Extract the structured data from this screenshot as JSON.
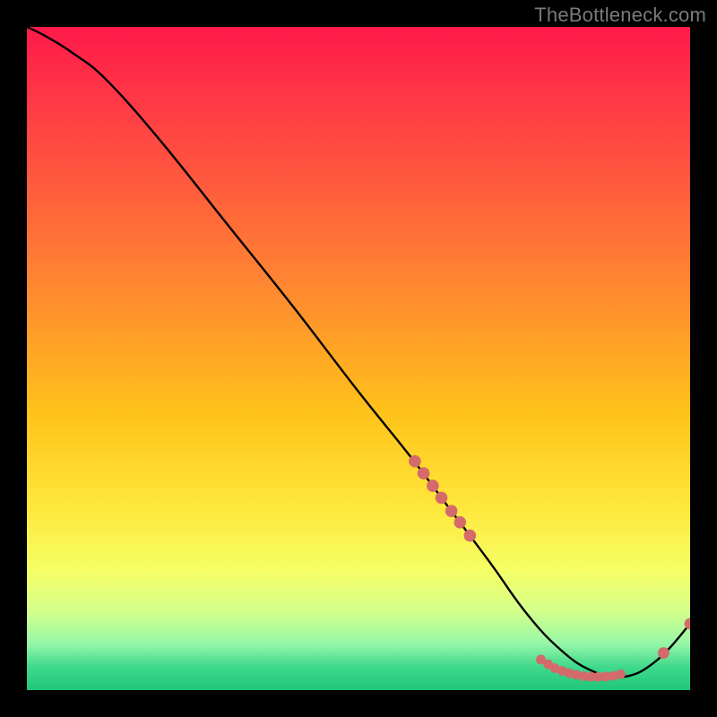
{
  "watermark": "TheBottleneck.com",
  "chart_data": {
    "type": "line",
    "title": "",
    "xlabel": "",
    "ylabel": "",
    "xlim": [
      0,
      100
    ],
    "ylim": [
      0,
      100
    ],
    "grid": false,
    "legend": false,
    "gradient_stops": [
      {
        "offset": 0.0,
        "color": "#ff1a4b"
      },
      {
        "offset": 0.2,
        "color": "#ff5040"
      },
      {
        "offset": 0.4,
        "color": "#ff8a30"
      },
      {
        "offset": 0.58,
        "color": "#ffc21a"
      },
      {
        "offset": 0.72,
        "color": "#ffe63a"
      },
      {
        "offset": 0.82,
        "color": "#f5ff66"
      },
      {
        "offset": 0.88,
        "color": "#d5ff8a"
      },
      {
        "offset": 0.93,
        "color": "#96f7a8"
      },
      {
        "offset": 0.965,
        "color": "#3fd98c"
      },
      {
        "offset": 1.0,
        "color": "#1fc67a"
      }
    ],
    "series": [
      {
        "name": "bottleneck-curve",
        "color": "#000000",
        "x": [
          0.0,
          3.0,
          7.0,
          12.0,
          20.0,
          30.0,
          40.0,
          50.0,
          58.0,
          64.0,
          70.0,
          75.0,
          80.0,
          85.0,
          90.0,
          95.0,
          100.0
        ],
        "y": [
          100.0,
          98.5,
          96.0,
          92.0,
          83.0,
          70.5,
          58.0,
          45.0,
          35.0,
          27.0,
          19.0,
          12.0,
          6.5,
          3.0,
          2.0,
          4.5,
          10.0
        ]
      }
    ],
    "marker_clusters": [
      {
        "name": "upper-slope-markers",
        "color": "#d46a6a",
        "radius": 6.8,
        "points": [
          {
            "x": 58.5,
            "y": 34.5
          },
          {
            "x": 59.8,
            "y": 32.7
          },
          {
            "x": 61.2,
            "y": 30.8
          },
          {
            "x": 62.5,
            "y": 29.0
          },
          {
            "x": 64.0,
            "y": 27.0
          },
          {
            "x": 65.3,
            "y": 25.3
          },
          {
            "x": 66.8,
            "y": 23.3
          }
        ]
      },
      {
        "name": "minimum-cluster-markers",
        "color": "#d46a6a",
        "radius": 5.4,
        "points": [
          {
            "x": 77.5,
            "y": 4.6
          },
          {
            "x": 78.6,
            "y": 3.9
          },
          {
            "x": 79.6,
            "y": 3.3
          },
          {
            "x": 80.7,
            "y": 2.9
          },
          {
            "x": 81.8,
            "y": 2.55
          },
          {
            "x": 82.9,
            "y": 2.3
          },
          {
            "x": 84.0,
            "y": 2.1
          },
          {
            "x": 85.1,
            "y": 2.0
          },
          {
            "x": 86.2,
            "y": 2.0
          },
          {
            "x": 87.3,
            "y": 2.05
          },
          {
            "x": 88.4,
            "y": 2.15
          },
          {
            "x": 89.5,
            "y": 2.4
          }
        ]
      },
      {
        "name": "rising-tail-markers",
        "color": "#d46a6a",
        "radius": 6.4,
        "points": [
          {
            "x": 96.0,
            "y": 5.6
          },
          {
            "x": 100.0,
            "y": 10.0
          }
        ]
      }
    ]
  }
}
